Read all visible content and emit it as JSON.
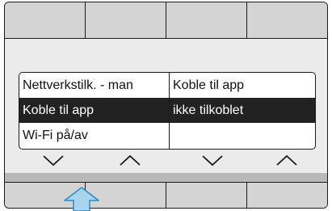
{
  "menu": {
    "left_items": [
      {
        "label": "Nettverkstilk. - man",
        "selected": false
      },
      {
        "label": "Koble til app",
        "selected": true
      },
      {
        "label": "Wi-Fi på/av",
        "selected": false
      }
    ],
    "right_items": [
      {
        "label": "Koble til app",
        "selected": false
      },
      {
        "label": "ikke tilkoblet",
        "selected": true
      },
      {
        "label": "",
        "selected": false
      }
    ]
  },
  "nav_arrows": [
    "chevron-down-icon",
    "chevron-up-icon",
    "chevron-down-icon",
    "chevron-up-icon"
  ],
  "pointer": "up-arrow-icon",
  "colors": {
    "button_gray": "#d4d4d4",
    "screen_bg": "#ebebeb",
    "selected_bg": "#222222",
    "pointer_fill": "#a8d4ef",
    "pointer_stroke": "#2a8bc8"
  }
}
